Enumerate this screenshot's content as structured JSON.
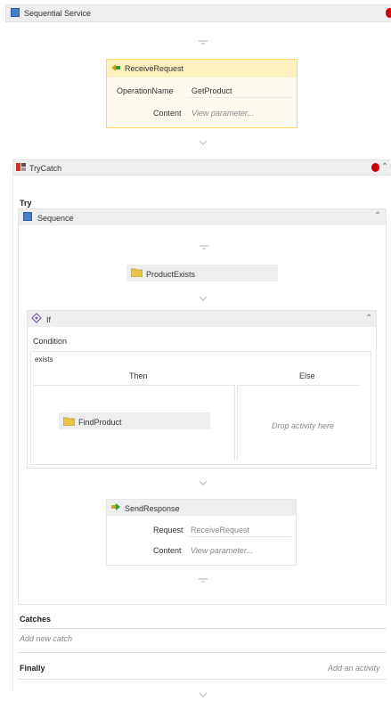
{
  "colors": {
    "header_bg": "#eeeeee",
    "selected_bg": "#fff0bf",
    "selected_border": "#ffd864",
    "error_red": "#cc0000",
    "folder_yellow": "#e8c547",
    "service_blue": "#4a7fc1"
  },
  "root": {
    "title": "Sequential Service"
  },
  "receive": {
    "title": "ReceiveRequest",
    "operation_label": "OperationName",
    "operation_value": "GetProduct",
    "content_label": "Content",
    "content_value": "View parameter..."
  },
  "trycatch": {
    "title": "TryCatch",
    "try_label": "Try"
  },
  "sequence": {
    "title": "Sequence"
  },
  "product_exists": {
    "title": "ProductExists"
  },
  "if_block": {
    "title": "If",
    "condition_label": "Condition",
    "condition_value": "exists",
    "then_label": "Then",
    "else_label": "Else",
    "else_drop": "Drop activity here"
  },
  "find_product": {
    "title": "FindProduct"
  },
  "send": {
    "title": "SendResponse",
    "request_label": "Request",
    "request_value": "ReceiveRequest",
    "content_label": "Content",
    "content_value": "View parameter..."
  },
  "catches": {
    "label": "Catches",
    "add": "Add new catch"
  },
  "finally": {
    "label": "Finally",
    "add": "Add an activity"
  }
}
